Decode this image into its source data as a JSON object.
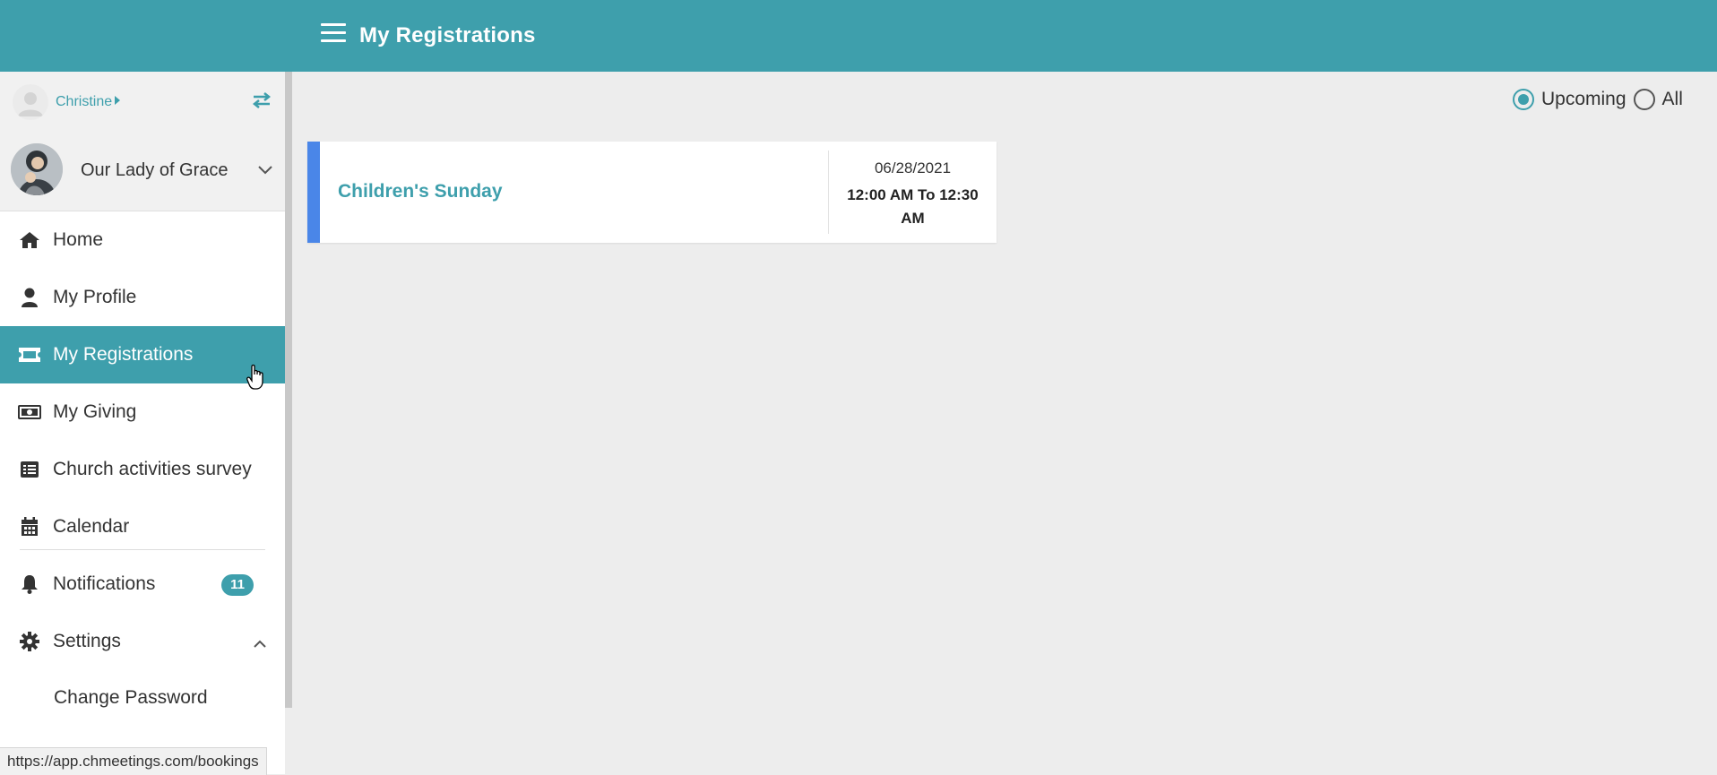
{
  "header": {
    "title": "My Registrations",
    "menu_icon": "hamburger-icon",
    "bg_color": "#3e9fac"
  },
  "sidebar": {
    "user": {
      "name": "Christine",
      "avatar_icon": "user-avatar-icon",
      "switch_icon": "swap-arrows-icon"
    },
    "org": {
      "name": "Our Lady of Grace",
      "chevron_icon": "chevron-down-icon"
    },
    "items": [
      {
        "label": "Home",
        "icon": "home-icon",
        "active": false
      },
      {
        "label": "My Profile",
        "icon": "user-icon",
        "active": false
      },
      {
        "label": "My Registrations",
        "icon": "ticket-icon",
        "active": true
      },
      {
        "label": "My Giving",
        "icon": "money-bill-icon",
        "active": false
      },
      {
        "label": "Church activities survey",
        "icon": "list-icon",
        "active": false
      },
      {
        "label": "Calendar",
        "icon": "calendar-icon",
        "active": false
      },
      {
        "label": "Notifications",
        "icon": "bell-icon",
        "active": false,
        "badge": "11"
      },
      {
        "label": "Settings",
        "icon": "gear-icon",
        "active": false,
        "expanded": true
      }
    ],
    "settings_sub": [
      {
        "label": "Change Password"
      }
    ],
    "accent_color": "#3e9fac"
  },
  "filters": {
    "options": [
      {
        "label": "Upcoming",
        "checked": true
      },
      {
        "label": "All",
        "checked": false
      }
    ]
  },
  "registrations": [
    {
      "title": "Children's Sunday",
      "date": "06/28/2021",
      "time": "12:00 AM To 12:30 AM",
      "accent_color": "#4a86e8"
    }
  ],
  "status_bar": {
    "url": "https://app.chmeetings.com/bookings"
  }
}
